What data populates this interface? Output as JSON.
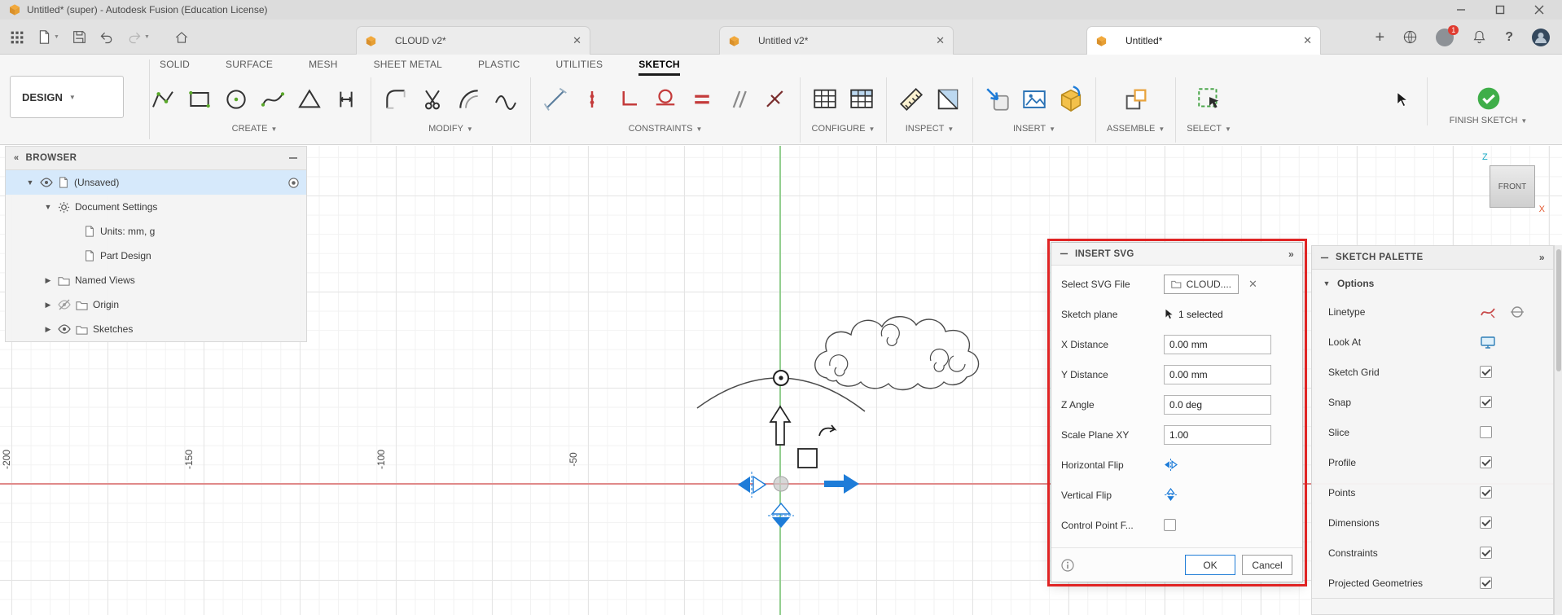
{
  "titlebar": {
    "title": "Untitled* (super) - Autodesk Fusion (Education License)"
  },
  "tabbar": {
    "tabs": [
      {
        "label": "CLOUD v2*"
      },
      {
        "label": "Untitled v2*"
      },
      {
        "label": "Untitled*"
      }
    ],
    "notification_count": "1",
    "help_glyph": "?"
  },
  "ribbon": {
    "workspace": "DESIGN",
    "tabs": [
      {
        "label": "SOLID"
      },
      {
        "label": "SURFACE"
      },
      {
        "label": "MESH"
      },
      {
        "label": "SHEET METAL"
      },
      {
        "label": "PLASTIC"
      },
      {
        "label": "UTILITIES"
      },
      {
        "label": "SKETCH"
      }
    ],
    "groups": {
      "create": "CREATE",
      "modify": "MODIFY",
      "constraints": "CONSTRAINTS",
      "configure": "CONFIGURE",
      "inspect": "INSPECT",
      "insert": "INSERT",
      "assemble": "ASSEMBLE",
      "select": "SELECT"
    },
    "finish": "FINISH SKETCH"
  },
  "browser": {
    "title": "BROWSER",
    "items": [
      {
        "label": "(Unsaved)"
      },
      {
        "label": "Document Settings"
      },
      {
        "label": "Units: mm, g"
      },
      {
        "label": "Part Design"
      },
      {
        "label": "Named Views"
      },
      {
        "label": "Origin"
      },
      {
        "label": "Sketches"
      }
    ]
  },
  "canvas": {
    "ruler_labels": [
      "-200",
      "-150",
      "-100",
      "-50"
    ],
    "viewcube": {
      "face": "FRONT",
      "axis_z": "Z",
      "axis_x": "X"
    }
  },
  "dialog": {
    "title": "INSERT SVG",
    "rows": {
      "file": {
        "label": "Select SVG File",
        "value": "CLOUD...."
      },
      "plane": {
        "label": "Sketch plane",
        "value": "1 selected"
      },
      "x": {
        "label": "X Distance",
        "value": "0.00 mm"
      },
      "y": {
        "label": "Y Distance",
        "value": "0.00 mm"
      },
      "angle": {
        "label": "Z Angle",
        "value": "0.0 deg"
      },
      "scale": {
        "label": "Scale Plane XY",
        "value": "1.00"
      },
      "hflip": {
        "label": "Horizontal Flip"
      },
      "vflip": {
        "label": "Vertical Flip"
      },
      "cpf": {
        "label": "Control Point F...",
        "checked": false
      }
    },
    "ok": "OK",
    "cancel": "Cancel"
  },
  "palette": {
    "title": "SKETCH PALETTE",
    "section": "Options",
    "rows": {
      "linetype": {
        "label": "Linetype"
      },
      "lookat": {
        "label": "Look At"
      },
      "grid": {
        "label": "Sketch Grid",
        "checked": true
      },
      "snap": {
        "label": "Snap",
        "checked": true
      },
      "slice": {
        "label": "Slice",
        "checked": false
      },
      "profile": {
        "label": "Profile",
        "checked": true
      },
      "points": {
        "label": "Points",
        "checked": true
      },
      "dimensions": {
        "label": "Dimensions",
        "checked": true
      },
      "constraints": {
        "label": "Constraints",
        "checked": true
      },
      "projected": {
        "label": "Projected Geometries",
        "checked": true
      }
    }
  },
  "colors": {
    "accent_blue": "#1e7cd8",
    "axis_red": "#e08a8a",
    "axis_green": "#93ce90",
    "annotation_red": "#e02424",
    "finish_green": "#3fae49",
    "cube_orange": "#f2a93c"
  }
}
